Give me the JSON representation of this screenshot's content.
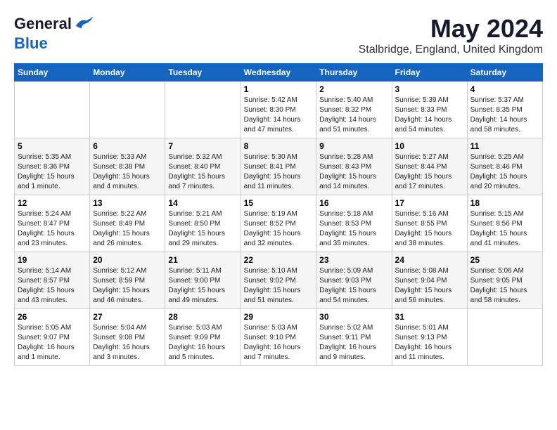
{
  "header": {
    "logo_line1": "General",
    "logo_line2": "Blue",
    "month_year": "May 2024",
    "location": "Stalbridge, England, United Kingdom"
  },
  "days_of_week": [
    "Sunday",
    "Monday",
    "Tuesday",
    "Wednesday",
    "Thursday",
    "Friday",
    "Saturday"
  ],
  "weeks": [
    [
      {
        "day": "",
        "info": ""
      },
      {
        "day": "",
        "info": ""
      },
      {
        "day": "",
        "info": ""
      },
      {
        "day": "1",
        "info": "Sunrise: 5:42 AM\nSunset: 8:30 PM\nDaylight: 14 hours\nand 47 minutes."
      },
      {
        "day": "2",
        "info": "Sunrise: 5:40 AM\nSunset: 8:32 PM\nDaylight: 14 hours\nand 51 minutes."
      },
      {
        "day": "3",
        "info": "Sunrise: 5:39 AM\nSunset: 8:33 PM\nDaylight: 14 hours\nand 54 minutes."
      },
      {
        "day": "4",
        "info": "Sunrise: 5:37 AM\nSunset: 8:35 PM\nDaylight: 14 hours\nand 58 minutes."
      }
    ],
    [
      {
        "day": "5",
        "info": "Sunrise: 5:35 AM\nSunset: 8:36 PM\nDaylight: 15 hours\nand 1 minute."
      },
      {
        "day": "6",
        "info": "Sunrise: 5:33 AM\nSunset: 8:38 PM\nDaylight: 15 hours\nand 4 minutes."
      },
      {
        "day": "7",
        "info": "Sunrise: 5:32 AM\nSunset: 8:40 PM\nDaylight: 15 hours\nand 7 minutes."
      },
      {
        "day": "8",
        "info": "Sunrise: 5:30 AM\nSunset: 8:41 PM\nDaylight: 15 hours\nand 11 minutes."
      },
      {
        "day": "9",
        "info": "Sunrise: 5:28 AM\nSunset: 8:43 PM\nDaylight: 15 hours\nand 14 minutes."
      },
      {
        "day": "10",
        "info": "Sunrise: 5:27 AM\nSunset: 8:44 PM\nDaylight: 15 hours\nand 17 minutes."
      },
      {
        "day": "11",
        "info": "Sunrise: 5:25 AM\nSunset: 8:46 PM\nDaylight: 15 hours\nand 20 minutes."
      }
    ],
    [
      {
        "day": "12",
        "info": "Sunrise: 5:24 AM\nSunset: 8:47 PM\nDaylight: 15 hours\nand 23 minutes."
      },
      {
        "day": "13",
        "info": "Sunrise: 5:22 AM\nSunset: 8:49 PM\nDaylight: 15 hours\nand 26 minutes."
      },
      {
        "day": "14",
        "info": "Sunrise: 5:21 AM\nSunset: 8:50 PM\nDaylight: 15 hours\nand 29 minutes."
      },
      {
        "day": "15",
        "info": "Sunrise: 5:19 AM\nSunset: 8:52 PM\nDaylight: 15 hours\nand 32 minutes."
      },
      {
        "day": "16",
        "info": "Sunrise: 5:18 AM\nSunset: 8:53 PM\nDaylight: 15 hours\nand 35 minutes."
      },
      {
        "day": "17",
        "info": "Sunrise: 5:16 AM\nSunset: 8:55 PM\nDaylight: 15 hours\nand 38 minutes."
      },
      {
        "day": "18",
        "info": "Sunrise: 5:15 AM\nSunset: 8:56 PM\nDaylight: 15 hours\nand 41 minutes."
      }
    ],
    [
      {
        "day": "19",
        "info": "Sunrise: 5:14 AM\nSunset: 8:57 PM\nDaylight: 15 hours\nand 43 minutes."
      },
      {
        "day": "20",
        "info": "Sunrise: 5:12 AM\nSunset: 8:59 PM\nDaylight: 15 hours\nand 46 minutes."
      },
      {
        "day": "21",
        "info": "Sunrise: 5:11 AM\nSunset: 9:00 PM\nDaylight: 15 hours\nand 49 minutes."
      },
      {
        "day": "22",
        "info": "Sunrise: 5:10 AM\nSunset: 9:02 PM\nDaylight: 15 hours\nand 51 minutes."
      },
      {
        "day": "23",
        "info": "Sunrise: 5:09 AM\nSunset: 9:03 PM\nDaylight: 15 hours\nand 54 minutes."
      },
      {
        "day": "24",
        "info": "Sunrise: 5:08 AM\nSunset: 9:04 PM\nDaylight: 15 hours\nand 56 minutes."
      },
      {
        "day": "25",
        "info": "Sunrise: 5:06 AM\nSunset: 9:05 PM\nDaylight: 15 hours\nand 58 minutes."
      }
    ],
    [
      {
        "day": "26",
        "info": "Sunrise: 5:05 AM\nSunset: 9:07 PM\nDaylight: 16 hours\nand 1 minute."
      },
      {
        "day": "27",
        "info": "Sunrise: 5:04 AM\nSunset: 9:08 PM\nDaylight: 16 hours\nand 3 minutes."
      },
      {
        "day": "28",
        "info": "Sunrise: 5:03 AM\nSunset: 9:09 PM\nDaylight: 16 hours\nand 5 minutes."
      },
      {
        "day": "29",
        "info": "Sunrise: 5:03 AM\nSunset: 9:10 PM\nDaylight: 16 hours\nand 7 minutes."
      },
      {
        "day": "30",
        "info": "Sunrise: 5:02 AM\nSunset: 9:11 PM\nDaylight: 16 hours\nand 9 minutes."
      },
      {
        "day": "31",
        "info": "Sunrise: 5:01 AM\nSunset: 9:13 PM\nDaylight: 16 hours\nand 11 minutes."
      },
      {
        "day": "",
        "info": ""
      }
    ]
  ]
}
